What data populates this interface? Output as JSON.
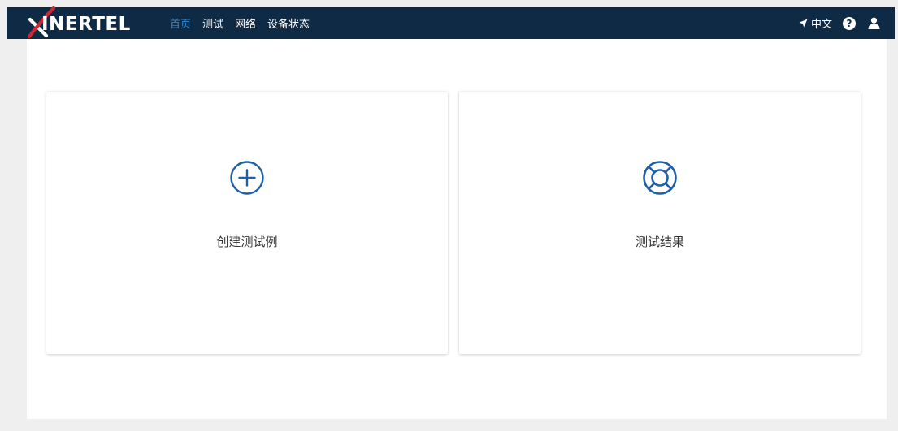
{
  "brand": {
    "name": "XINERTEL",
    "text_after_mark": "INERTEL",
    "mark_color": "#d4262f"
  },
  "nav": {
    "items": [
      {
        "label": "首页",
        "active": true
      },
      {
        "label": "测试",
        "active": false
      },
      {
        "label": "网络",
        "active": false
      },
      {
        "label": "设备状态",
        "active": false
      }
    ],
    "language": "中文"
  },
  "cards": [
    {
      "label": "创建测试例",
      "icon": "plus-circle-icon"
    },
    {
      "label": "测试结果",
      "icon": "lifebuoy-icon"
    }
  ],
  "colors": {
    "navbar": "#0e2a44",
    "active_link": "#2f86d2",
    "icon": "#1f5fa8",
    "page_bg": "#efefef"
  }
}
